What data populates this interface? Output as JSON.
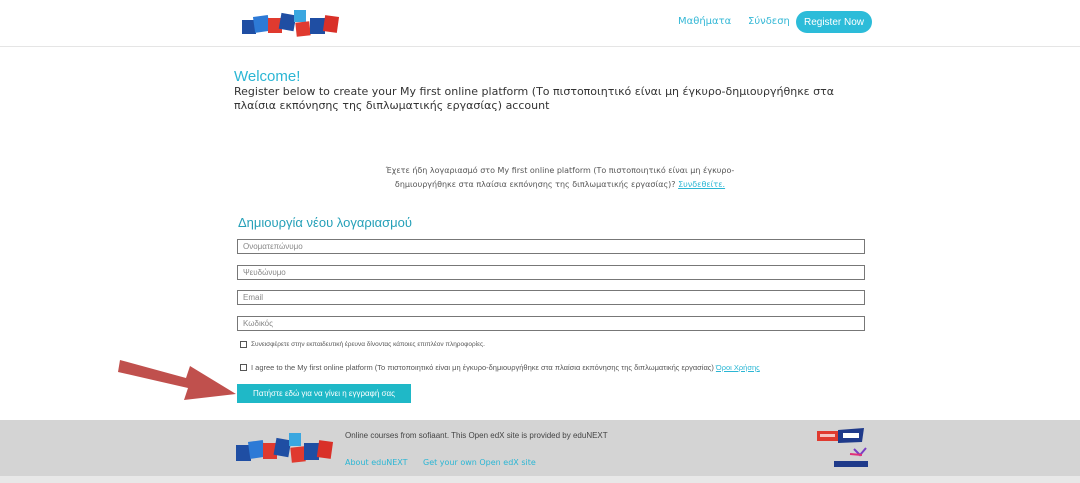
{
  "header": {
    "nav_courses": "Μαθήματα",
    "nav_login": "Σύνδεση",
    "register_button": "Register Now"
  },
  "welcome": {
    "title": "Welcome!",
    "text": "Register below to create your My first online platform (Το πιστοποιητικό είναι μη έγκυρο-δημιουργήθηκε στα πλαίσια εκπόνησης της διπλωματικής εργασίας) account"
  },
  "have_account": {
    "text": "Έχετε ήδη λογαριασμό στο My first online platform (Το πιστοποιητικό είναι μη έγκυρο-δημιουργήθηκε στα πλαίσια εκπόνησης της διπλωματικής εργασίας)?",
    "link": "Συνδεθείτε."
  },
  "form": {
    "title": "Δημιουργία νέου λογαριασμού",
    "fullname_placeholder": "Ονοματεπώνυμο",
    "username_placeholder": "Ψευδώνυμο",
    "email_placeholder": "Email",
    "password_placeholder": "Κωδικός",
    "research_checkbox": "Συνεισφέρετε στην εκπαιδευτική έρευνα δίνοντας κάποιες επιπλέον πληροφορίες.",
    "terms_checkbox": "I agree to the My first online platform (Το πιστοποιητικό είναι μη έγκυρο-δημιουργήθηκε στα πλαίσια εκπόνησης της διπλωματικής εργασίας)",
    "terms_link": "Όροι Χρήσης",
    "submit_button": "Πατήστε εδώ για να γίνει η εγγραφή σας"
  },
  "footer": {
    "text": "Online courses from sofiaant. This Open edX site is provided by eduNEXT",
    "link_about": "About eduNEXT",
    "link_get": "Get your own Open edX site"
  },
  "colors": {
    "accent": "#2bb6d4",
    "button": "#1fb8c7",
    "arrow": "#c0504d",
    "footer_bg": "#d4d4d4"
  }
}
